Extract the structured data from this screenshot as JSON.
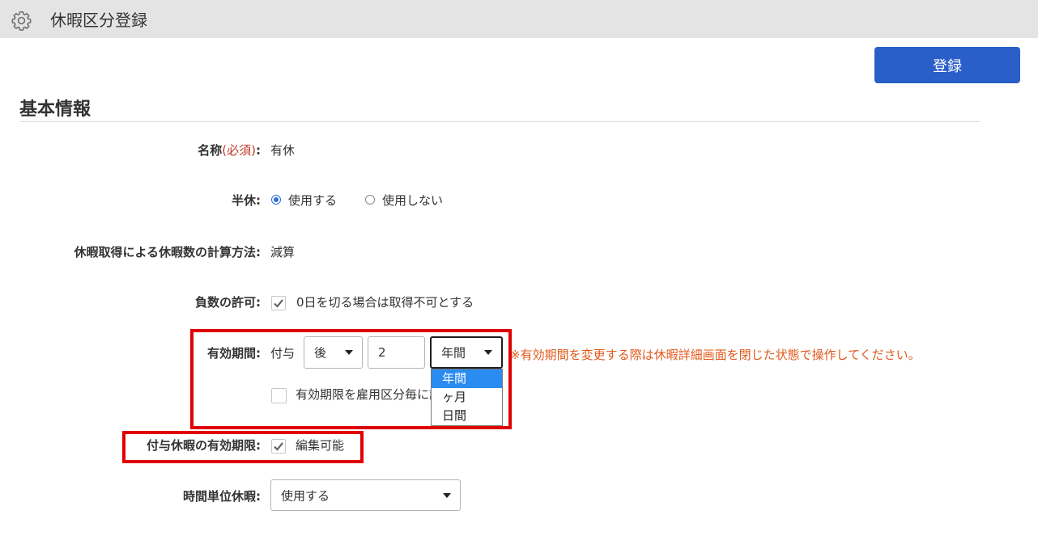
{
  "header": {
    "title": "休暇区分登録",
    "icon": "gear-icon"
  },
  "toolbar": {
    "register_label": "登録"
  },
  "section": {
    "title": "基本情報"
  },
  "form": {
    "name": {
      "label": "名称",
      "required": "(必須)",
      "colon": ":",
      "value": "有休"
    },
    "half_day": {
      "label": "半休:",
      "options": [
        {
          "label": "使用する",
          "checked": true
        },
        {
          "label": "使用しない",
          "checked": false
        }
      ]
    },
    "calc_method": {
      "label": "休暇取得による休暇数の計算方法:",
      "value": "減算"
    },
    "negative": {
      "label": "負数の許可:",
      "checkbox_label": "0日を切る場合は取得不可とする",
      "checked": true
    },
    "validity": {
      "label": "有効期間:",
      "prefix": "付与",
      "timing_value": "後",
      "amount_value": "2",
      "unit_value": "年間",
      "unit_options": [
        "年間",
        "ヶ月",
        "日間"
      ],
      "note": "※有効期間を変更する際は休暇詳細画面を閉じた状態で操作してください。",
      "per_employment_label": "有効期限を雇用区分毎に設定する",
      "per_employment_checked": false
    },
    "granted_validity": {
      "label": "付与休暇の有効期限:",
      "checkbox_label": "編集可能",
      "checked": true
    },
    "hourly": {
      "label": "時間単位休暇:",
      "value": "使用する"
    }
  },
  "colors": {
    "accent": "#2a5fc9",
    "highlight": "#e00000",
    "note": "#e05a1b",
    "required": "#c0392b"
  }
}
